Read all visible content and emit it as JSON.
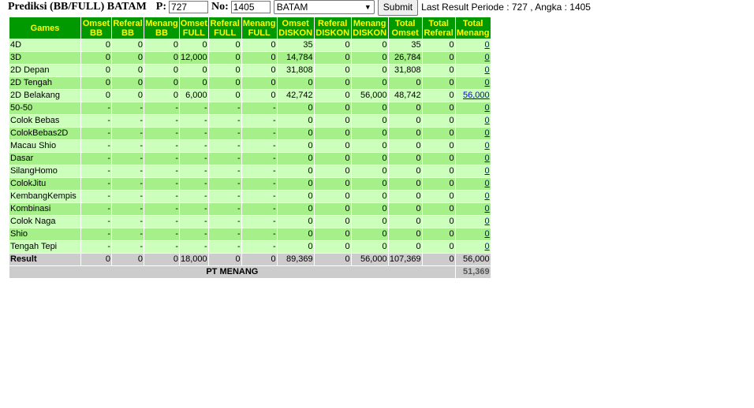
{
  "header": {
    "title": "Prediksi (BB/FULL) BATAM",
    "p_label": "P:",
    "p_value": "727",
    "no_label": "No:",
    "no_value": "1405",
    "select_value": "BATAM",
    "submit_label": "Submit",
    "last_result": "Last Result Periode : 727 , Angka : 1405"
  },
  "table": {
    "columns": [
      [
        "Games"
      ],
      [
        "Omset",
        "BB"
      ],
      [
        "Referal",
        "BB"
      ],
      [
        "Menang",
        "BB"
      ],
      [
        "Omset",
        "FULL"
      ],
      [
        "Referal",
        "FULL"
      ],
      [
        "Menang",
        "FULL"
      ],
      [
        "Omset",
        "DISKON"
      ],
      [
        "Referal",
        "DISKON"
      ],
      [
        "Menang",
        "DISKON"
      ],
      [
        "Total",
        "Omset"
      ],
      [
        "Total",
        "Referal"
      ],
      [
        "Total",
        "Menang"
      ]
    ],
    "rows": [
      {
        "name": "4D",
        "v": [
          "0",
          "0",
          "0",
          "0",
          "0",
          "0",
          "35",
          "0",
          "0",
          "35",
          "0"
        ],
        "total": "0"
      },
      {
        "name": "3D",
        "v": [
          "0",
          "0",
          "0",
          "12,000",
          "0",
          "0",
          "14,784",
          "0",
          "0",
          "26,784",
          "0"
        ],
        "total": "0"
      },
      {
        "name": "2D Depan",
        "v": [
          "0",
          "0",
          "0",
          "0",
          "0",
          "0",
          "31,808",
          "0",
          "0",
          "31,808",
          "0"
        ],
        "total": "0"
      },
      {
        "name": "2D Tengah",
        "v": [
          "0",
          "0",
          "0",
          "0",
          "0",
          "0",
          "0",
          "0",
          "0",
          "0",
          "0"
        ],
        "total": "0"
      },
      {
        "name": "2D Belakang",
        "v": [
          "0",
          "0",
          "0",
          "6,000",
          "0",
          "0",
          "42,742",
          "0",
          "56,000",
          "48,742",
          "0"
        ],
        "total": "56,000"
      },
      {
        "name": "50-50",
        "v": [
          "-",
          "-",
          "-",
          "-",
          "-",
          "-",
          "0",
          "0",
          "0",
          "0",
          "0"
        ],
        "total": "0"
      },
      {
        "name": "Colok Bebas",
        "v": [
          "-",
          "-",
          "-",
          "-",
          "-",
          "-",
          "0",
          "0",
          "0",
          "0",
          "0"
        ],
        "total": "0"
      },
      {
        "name": "ColokBebas2D",
        "v": [
          "-",
          "-",
          "-",
          "-",
          "-",
          "-",
          "0",
          "0",
          "0",
          "0",
          "0"
        ],
        "total": "0"
      },
      {
        "name": "Macau Shio",
        "v": [
          "-",
          "-",
          "-",
          "-",
          "-",
          "-",
          "0",
          "0",
          "0",
          "0",
          "0"
        ],
        "total": "0"
      },
      {
        "name": "Dasar",
        "v": [
          "-",
          "-",
          "-",
          "-",
          "-",
          "-",
          "0",
          "0",
          "0",
          "0",
          "0"
        ],
        "total": "0"
      },
      {
        "name": "SilangHomo",
        "v": [
          "-",
          "-",
          "-",
          "-",
          "-",
          "-",
          "0",
          "0",
          "0",
          "0",
          "0"
        ],
        "total": "0"
      },
      {
        "name": "ColokJitu",
        "v": [
          "-",
          "-",
          "-",
          "-",
          "-",
          "-",
          "0",
          "0",
          "0",
          "0",
          "0"
        ],
        "total": "0"
      },
      {
        "name": "KembangKempis",
        "v": [
          "-",
          "-",
          "-",
          "-",
          "-",
          "-",
          "0",
          "0",
          "0",
          "0",
          "0"
        ],
        "total": "0"
      },
      {
        "name": "Kombinasi",
        "v": [
          "-",
          "-",
          "-",
          "-",
          "-",
          "-",
          "0",
          "0",
          "0",
          "0",
          "0"
        ],
        "total": "0"
      },
      {
        "name": "Colok Naga",
        "v": [
          "-",
          "-",
          "-",
          "-",
          "-",
          "-",
          "0",
          "0",
          "0",
          "0",
          "0"
        ],
        "total": "0"
      },
      {
        "name": "Shio",
        "v": [
          "-",
          "-",
          "-",
          "-",
          "-",
          "-",
          "0",
          "0",
          "0",
          "0",
          "0"
        ],
        "total": "0"
      },
      {
        "name": "Tengah Tepi",
        "v": [
          "-",
          "-",
          "-",
          "-",
          "-",
          "-",
          "0",
          "0",
          "0",
          "0",
          "0"
        ],
        "total": "0"
      }
    ],
    "result": {
      "name": "Result",
      "v": [
        "0",
        "0",
        "0",
        "18,000",
        "0",
        "0",
        "89,369",
        "0",
        "56,000",
        "107,369",
        "0"
      ],
      "total": "56,000"
    },
    "pt": {
      "label": "PT MENANG",
      "value": "51,369"
    }
  },
  "colors": {
    "header_bg": "#009900",
    "header_text": "#ffff00",
    "row_light": "#ccffbb",
    "row_dark": "#a6f08a",
    "result_bg": "#cccccc",
    "link": "#0000ee"
  }
}
